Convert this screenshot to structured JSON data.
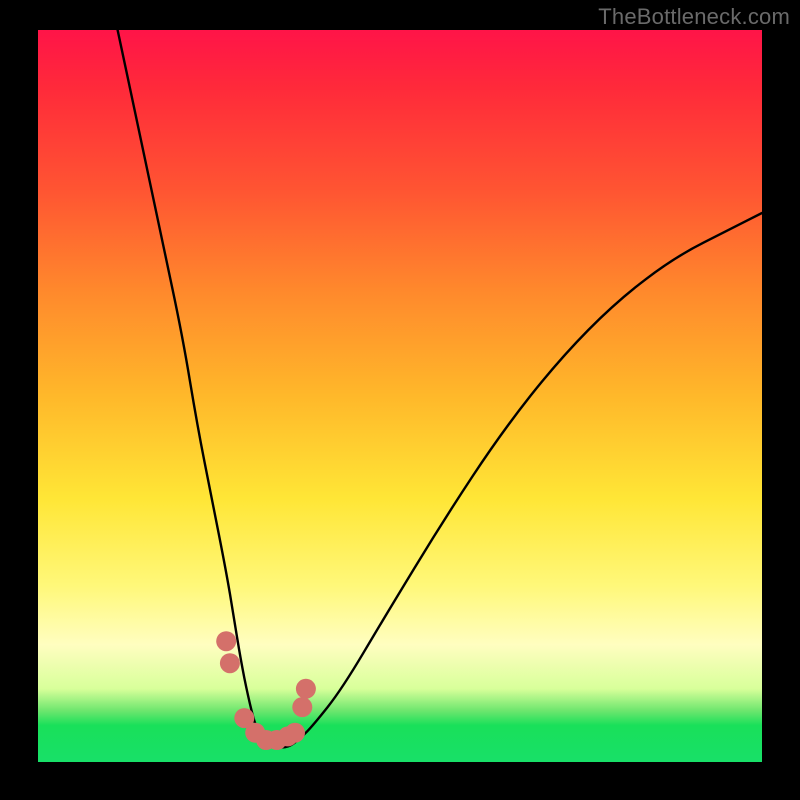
{
  "watermark": "TheBottleneck.com",
  "chart_data": {
    "type": "line",
    "title": "",
    "xlabel": "",
    "ylabel": "",
    "xlim": [
      0,
      100
    ],
    "ylim": [
      0,
      100
    ],
    "grid": false,
    "legend": false,
    "series": [
      {
        "name": "bottleneck-curve",
        "x": [
          11,
          14,
          17,
          20,
          22,
          24,
          26,
          27,
          28,
          29,
          30,
          31,
          32,
          33,
          34.5,
          36,
          38,
          42,
          48,
          56,
          64,
          72,
          80,
          88,
          96,
          100
        ],
        "y": [
          100,
          86,
          72,
          58,
          46,
          36,
          26,
          20,
          14,
          9,
          5,
          3,
          2,
          2,
          2,
          3,
          5,
          10,
          20,
          33,
          45,
          55,
          63,
          69,
          73,
          75
        ]
      }
    ],
    "markers": {
      "name": "highlighted-points",
      "color": "#d4706a",
      "points": [
        {
          "x": 26.0,
          "y": 16.5
        },
        {
          "x": 26.5,
          "y": 13.5
        },
        {
          "x": 28.5,
          "y": 6.0
        },
        {
          "x": 30.0,
          "y": 4.0
        },
        {
          "x": 31.5,
          "y": 3.0
        },
        {
          "x": 33.0,
          "y": 3.0
        },
        {
          "x": 34.5,
          "y": 3.5
        },
        {
          "x": 35.5,
          "y": 4.0
        },
        {
          "x": 36.5,
          "y": 7.5
        },
        {
          "x": 37.0,
          "y": 10.0
        }
      ]
    }
  }
}
